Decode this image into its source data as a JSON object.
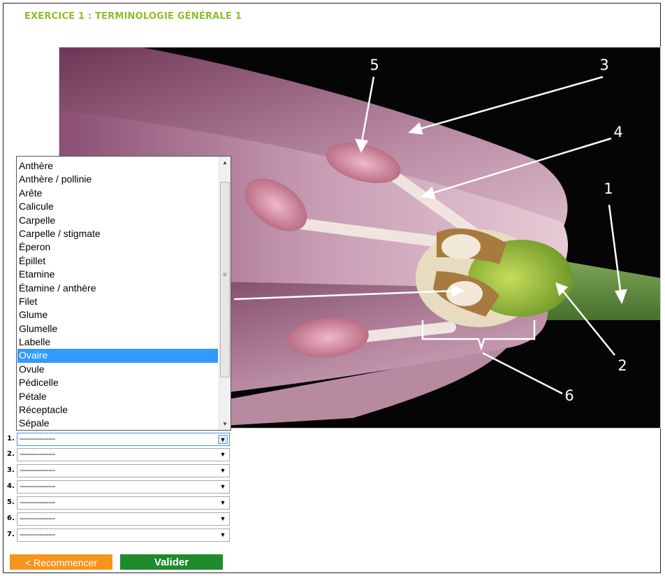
{
  "page": {
    "title": "EXERCICE 1 : TERMINOLOGIE GÉNÉRALE 1"
  },
  "diagram": {
    "labels": [
      "1",
      "2",
      "3",
      "4",
      "5",
      "6"
    ]
  },
  "dropdown": {
    "options": [
      "Anthère",
      "Anthère / pollinie",
      "Arête",
      "Calicule",
      "Carpelle",
      "Carpelle / stigmate",
      "Éperon",
      "Épillet",
      "Etamine",
      "Étamine / anthère",
      "Filet",
      "Glume",
      "Glumelle",
      "Labelle",
      "Ovaire",
      "Ovule",
      "Pédicelle",
      "Pétale",
      "Réceptacle",
      "Sépale"
    ],
    "highlighted": "Ovaire"
  },
  "answers": [
    {
      "number": "1.",
      "value": "----------------"
    },
    {
      "number": "2.",
      "value": "----------------"
    },
    {
      "number": "3.",
      "value": "----------------"
    },
    {
      "number": "4.",
      "value": "----------------"
    },
    {
      "number": "5.",
      "value": "----------------"
    },
    {
      "number": "6.",
      "value": "----------------"
    },
    {
      "number": "7.",
      "value": "----------------"
    }
  ],
  "buttons": {
    "reset_label": "< Recommencer",
    "submit_label": "Valider"
  },
  "colors": {
    "title": "#8cbf2a",
    "reset": "#f7941d",
    "submit": "#1f8a2e",
    "selection": "#3399ff"
  }
}
